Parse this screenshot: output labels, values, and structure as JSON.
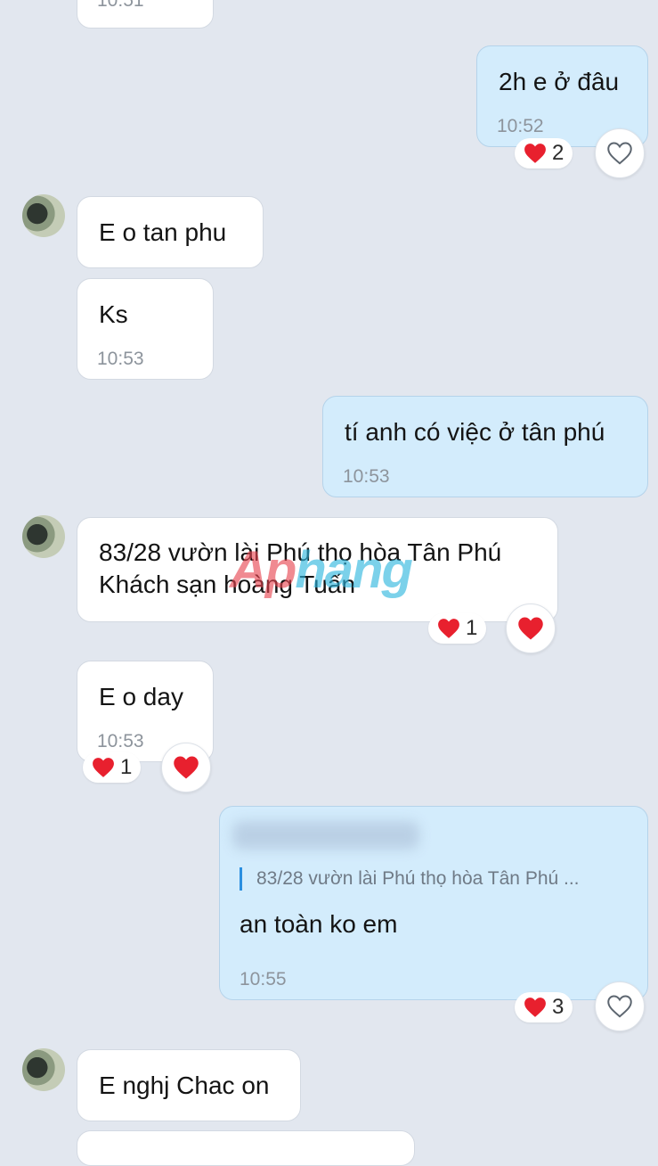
{
  "colors": {
    "background": "#e2e7ef",
    "incoming_bubble": "#ffffff",
    "outgoing_bubble": "#d3ecfc",
    "heart": "#e8202e",
    "quote_bar": "#2a8fe0"
  },
  "icons": {
    "reaction": "heart-icon",
    "react_button_empty": "heart-outline-icon",
    "react_button_filled": "heart-icon"
  },
  "messages": [
    {
      "id": "m0",
      "direction": "in",
      "text": "",
      "time": "10:51"
    },
    {
      "id": "m1",
      "direction": "out",
      "text": "2h e ở đâu",
      "time": "10:52",
      "reaction_count": "2"
    },
    {
      "id": "m2",
      "direction": "in",
      "text": "E o tan phu",
      "time": ""
    },
    {
      "id": "m3",
      "direction": "in",
      "text": "Ks",
      "time": "10:53"
    },
    {
      "id": "m4",
      "direction": "out",
      "text": "tí anh có việc ở tân phú",
      "time": "10:53"
    },
    {
      "id": "m5",
      "direction": "in",
      "line1": "83/28 vườn lài Phú thọ hòa Tân Phú",
      "line2": "Khách sạn hoàng Tuấn",
      "time": "",
      "reaction_count": "1"
    },
    {
      "id": "m6",
      "direction": "in",
      "text": "E o day",
      "time": "10:53",
      "reaction_count": "1"
    },
    {
      "id": "m7",
      "direction": "out",
      "quote": "83/28 vườn lài Phú thọ hòa Tân Phú ...",
      "text": "an toàn ko em",
      "time": "10:55",
      "reaction_count": "3"
    },
    {
      "id": "m8",
      "direction": "in",
      "text": "E nghj Chac on",
      "time": ""
    }
  ],
  "watermark": {
    "part1": "Ap",
    "part2": "hang"
  }
}
